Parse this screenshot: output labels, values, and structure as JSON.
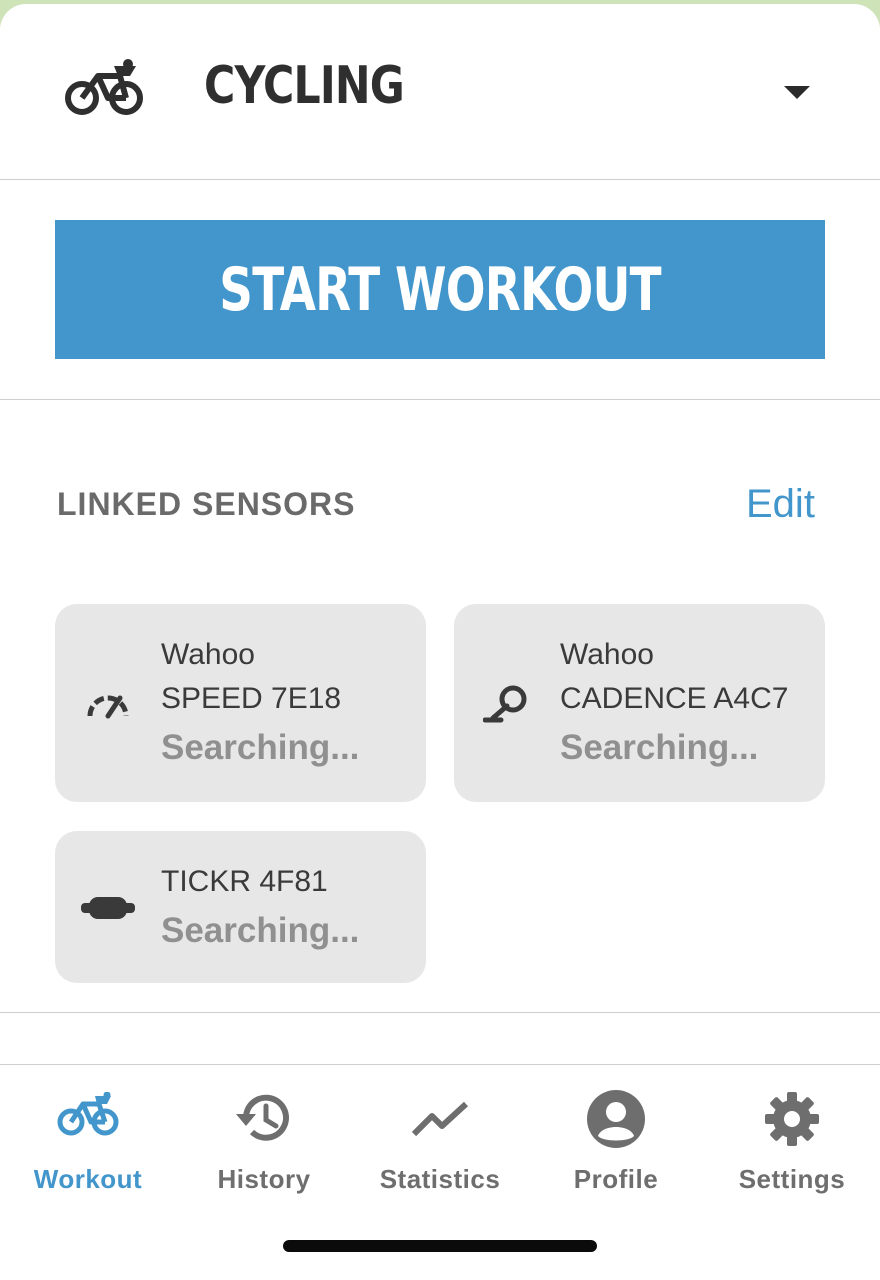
{
  "header": {
    "activity": "CYCLING"
  },
  "start_button": {
    "label": "START WORKOUT"
  },
  "sensors": {
    "title": "LINKED SENSORS",
    "edit_label": "Edit",
    "items": [
      {
        "brand": "Wahoo",
        "name": "SPEED 7E18",
        "status": "Searching...",
        "icon": "speedometer-icon"
      },
      {
        "brand": "Wahoo",
        "name": "CADENCE A4C7",
        "status": "Searching...",
        "icon": "crank-icon"
      },
      {
        "brand": "",
        "name": "TICKR 4F81",
        "status": "Searching...",
        "icon": "heart-strap-icon"
      }
    ]
  },
  "tabs": [
    {
      "label": "Workout",
      "icon": "bike-icon",
      "active": true
    },
    {
      "label": "History",
      "icon": "history-icon",
      "active": false
    },
    {
      "label": "Statistics",
      "icon": "trend-icon",
      "active": false
    },
    {
      "label": "Profile",
      "icon": "profile-icon",
      "active": false
    },
    {
      "label": "Settings",
      "icon": "gear-icon",
      "active": false
    }
  ],
  "colors": {
    "accent": "#4296cb",
    "card_bg": "#e7e7e7",
    "text_dark": "#2f2f2f",
    "text_gray": "#6e6e6e"
  }
}
